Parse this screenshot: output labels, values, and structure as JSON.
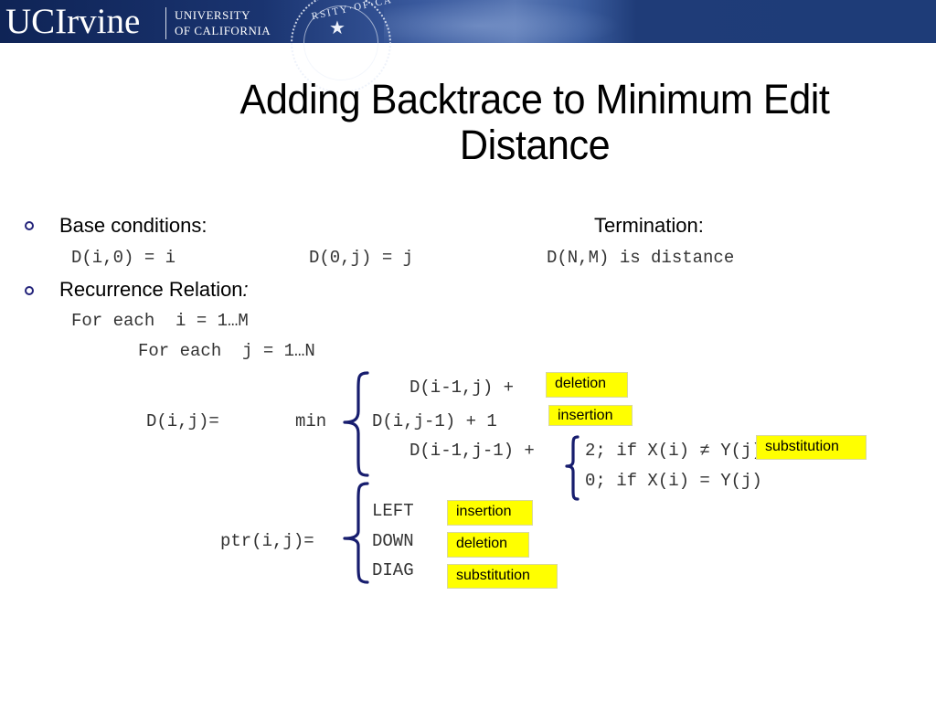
{
  "header": {
    "logo_main": "UCIrvine",
    "logo_sub_line1": "UNIVERSITY",
    "logo_sub_line2": "OF CALIFORNIA",
    "seal_text": "RSITY·OF·CA"
  },
  "slide": {
    "title_line1": "Adding Backtrace to Minimum Edit",
    "title_line2": "Distance",
    "bullets": [
      {
        "label": "Base conditions:"
      },
      {
        "label": "Recurrence Relation",
        "suffix": ":"
      }
    ],
    "base": {
      "left": "D(i,0) = i",
      "middle": "D(0,j) = j"
    },
    "termination": {
      "label": "Termination:",
      "value": "D(N,M) is distance"
    },
    "loops": {
      "outer": "For each  i = 1…M",
      "inner": "For each  j = 1…N"
    },
    "recurrence": {
      "lhs": "D(i,j)=",
      "op": "min",
      "cases": [
        "D(i-1,j) +",
        "D(i,j-1) + 1",
        "D(i-1,j-1) +"
      ],
      "sub_cases": [
        "2; if X(i) ≠ Y(j)",
        "0; if X(i) = Y(j)"
      ],
      "annotations": [
        "deletion",
        "insertion",
        "substitution"
      ]
    },
    "pointer": {
      "lhs": "ptr(i,j)=",
      "cases": [
        "LEFT",
        "DOWN",
        "DIAG"
      ],
      "annotations": [
        "insertion",
        "deletion",
        "substitution"
      ]
    }
  },
  "colors": {
    "header_blue": "#1e3c78",
    "highlight": "#ffff00",
    "brace": "#171d6e",
    "bullet": "#23237a"
  }
}
